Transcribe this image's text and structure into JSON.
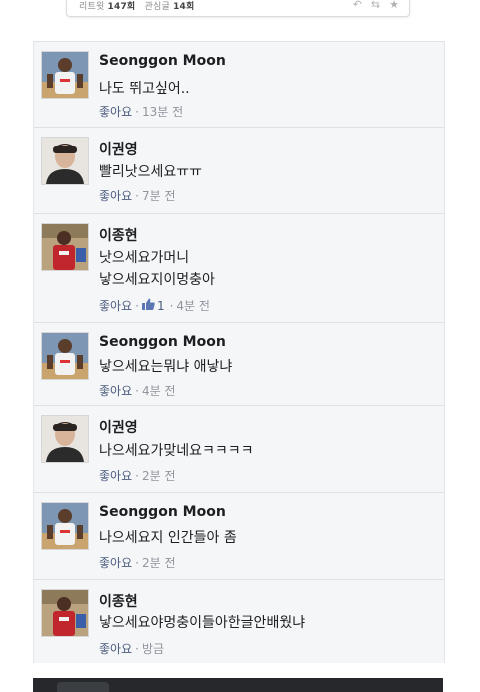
{
  "tweet": {
    "retweet_label": "리트윗",
    "retweet_count": "147회",
    "favorite_label": "관심글",
    "favorite_count": "14회",
    "actions": [
      "reply-icon",
      "retweet-icon",
      "favorite-icon"
    ]
  },
  "comments": [
    {
      "name": "Seonggon Moon",
      "lines": [
        "나도 뛰고싶어.."
      ],
      "like": "좋아요",
      "time": "13분 전",
      "avatar": "player-jersey"
    },
    {
      "name": "이권영",
      "lines": [
        "빨리낫으세요ㅠㅠ"
      ],
      "like": "좋아요",
      "time": "7분 전",
      "avatar": "portrait"
    },
    {
      "name": "이종현",
      "lines": [
        "낫으세요가머니",
        "낳으세요지이멍충아"
      ],
      "like": "좋아요",
      "reactions": "1",
      "time": "4분 전",
      "avatar": "player-red"
    },
    {
      "name": "Seonggon Moon",
      "lines": [
        "낳으세요는뭐냐 애낳냐"
      ],
      "like": "좋아요",
      "time": "4분 전",
      "avatar": "player-jersey"
    },
    {
      "name": "이권영",
      "lines": [
        "나으세요가맞네요ㅋㅋㅋㅋ"
      ],
      "like": "좋아요",
      "time": "2분 전",
      "avatar": "portrait"
    },
    {
      "name": "Seonggon Moon",
      "lines": [
        "나으세요지 인간들아 좀"
      ],
      "like": "좋아요",
      "time": "2분 전",
      "avatar": "player-jersey"
    },
    {
      "name": "이종현",
      "lines": [
        "낳으세요야멍충이들아한글안배웠냐"
      ],
      "like": "좋아요",
      "time": "방금",
      "avatar": "player-red"
    }
  ],
  "colors": {
    "panel_bg": "#f5f6f8",
    "name": "#1c1e21",
    "meta": "#90949c",
    "like_link": "#4b5c7e",
    "divider": "#dfe1e5"
  }
}
